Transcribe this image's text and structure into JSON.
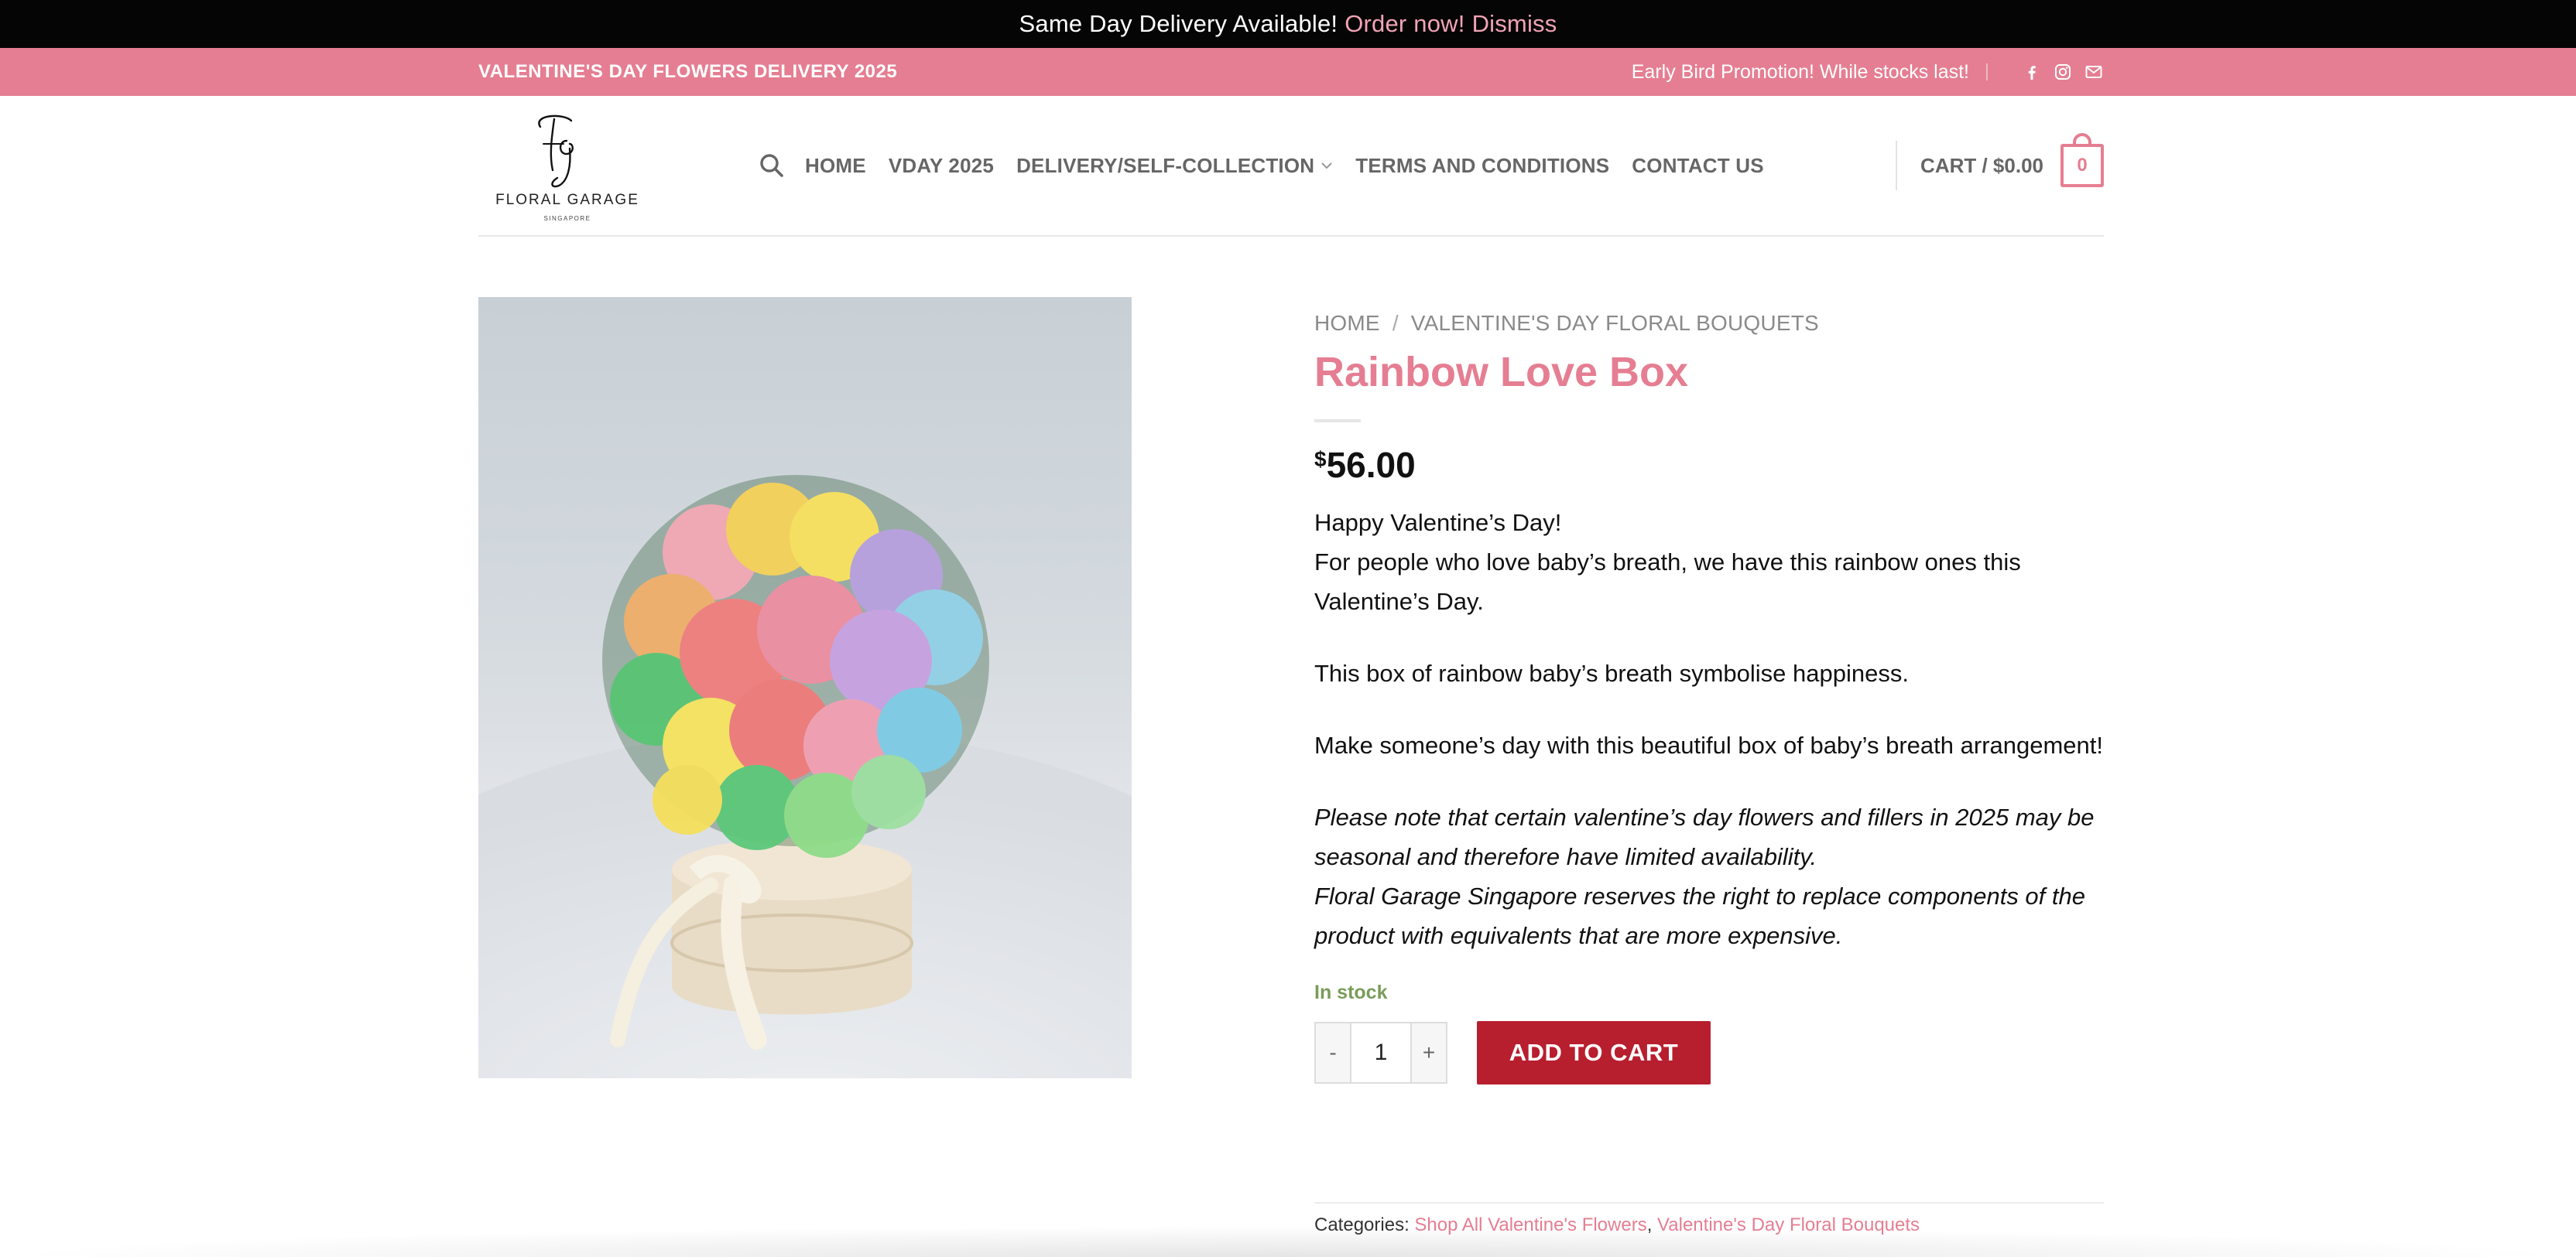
{
  "notice": {
    "text": "Same Day Delivery Available!",
    "order_link": "Order now!",
    "dismiss_link": "Dismiss"
  },
  "promo": {
    "left_text": "VALENTINE'S DAY FLOWERS DELIVERY 2025",
    "right_text": "Early Bird Promotion! While stocks last!",
    "social_icons": [
      "facebook-icon",
      "instagram-icon",
      "email-icon"
    ]
  },
  "header": {
    "logo_text": "FLORAL GARAGE",
    "logo_sub": "SINGAPORE",
    "nav": [
      {
        "label": "HOME"
      },
      {
        "label": "VDAY 2025"
      },
      {
        "label": "DELIVERY/SELF-COLLECTION"
      },
      {
        "label": "TERMS AND CONDITIONS"
      },
      {
        "label": "CONTACT US"
      }
    ],
    "cart_label": "CART / $0.00",
    "cart_count": "0"
  },
  "product": {
    "breadcrumb": [
      "HOME",
      "VALENTINE'S DAY FLORAL BOUQUETS"
    ],
    "breadcrumb_sep": "/",
    "title": "Rainbow Love Box",
    "currency": "$",
    "price": "56.00",
    "description": [
      "Happy Valentine’s Day!",
      "For people who love baby’s breath, we have this rainbow ones this Valentine’s Day.",
      "This box of rainbow baby’s breath symbolise happiness.",
      "Make someone’s day with this beautiful box of baby’s breath arrangement!",
      "Please note that certain valentine’s day flowers and fillers in 2025 may be seasonal and therefore have limited availability.",
      "Floral Garage Singapore reserves the right to replace components of the product with equivalents that are more expensive."
    ],
    "stock": "In stock",
    "qty_minus": "-",
    "qty_value": "1",
    "qty_plus": "+",
    "add_to_cart": "ADD TO CART",
    "categories_label": "Categories:",
    "categories": [
      "Shop All Valentine's Flowers",
      "Valentine's Day Floral Bouquets"
    ]
  },
  "colors": {
    "brand_pink": "#e57e92",
    "add_to_cart_red": "#b71f2f",
    "in_stock_green": "#7a9c59"
  }
}
